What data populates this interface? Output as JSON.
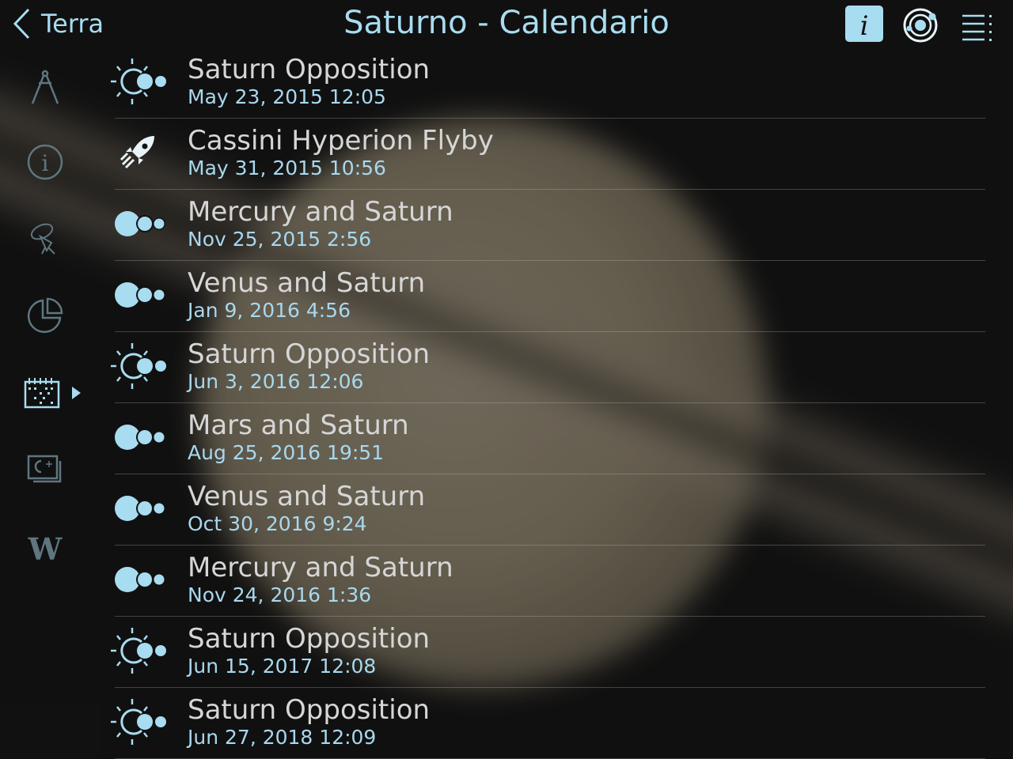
{
  "header": {
    "back_label": "Terra",
    "title": "Saturno - Calendario"
  },
  "toolbar": {
    "info": "info-icon",
    "orbit": "orbit-icon",
    "menu": "list-icon"
  },
  "sidebar": {
    "items": [
      {
        "icon": "compass-icon"
      },
      {
        "icon": "info-icon"
      },
      {
        "icon": "satellite-icon"
      },
      {
        "icon": "pie-chart-icon"
      },
      {
        "icon": "calendar-icon",
        "selected": true
      },
      {
        "icon": "gallery-icon"
      },
      {
        "icon": "wikipedia-icon",
        "label": "W"
      }
    ]
  },
  "events": [
    {
      "type": "opposition",
      "title": "Saturn Opposition",
      "date": "May 23, 2015 12:05"
    },
    {
      "type": "flyby",
      "title": "Cassini Hyperion Flyby",
      "date": "May 31, 2015 10:56"
    },
    {
      "type": "conjunction",
      "title": "Mercury and Saturn",
      "date": "Nov 25, 2015 2:56"
    },
    {
      "type": "conjunction",
      "title": "Venus and Saturn",
      "date": "Jan 9, 2016 4:56"
    },
    {
      "type": "opposition",
      "title": "Saturn Opposition",
      "date": "Jun 3, 2016 12:06"
    },
    {
      "type": "conjunction",
      "title": "Mars and Saturn",
      "date": "Aug 25, 2016 19:51"
    },
    {
      "type": "conjunction",
      "title": "Venus and Saturn",
      "date": "Oct 30, 2016 9:24"
    },
    {
      "type": "conjunction",
      "title": "Mercury and Saturn",
      "date": "Nov 24, 2016 1:36"
    },
    {
      "type": "opposition",
      "title": "Saturn Opposition",
      "date": "Jun 15, 2017 12:08"
    },
    {
      "type": "opposition",
      "title": "Saturn Opposition",
      "date": "Jun 27, 2018 12:09"
    }
  ],
  "colors": {
    "accent": "#a8dcf0",
    "sidebar_icon": "#5f7680",
    "text": "#d6d6d6"
  }
}
